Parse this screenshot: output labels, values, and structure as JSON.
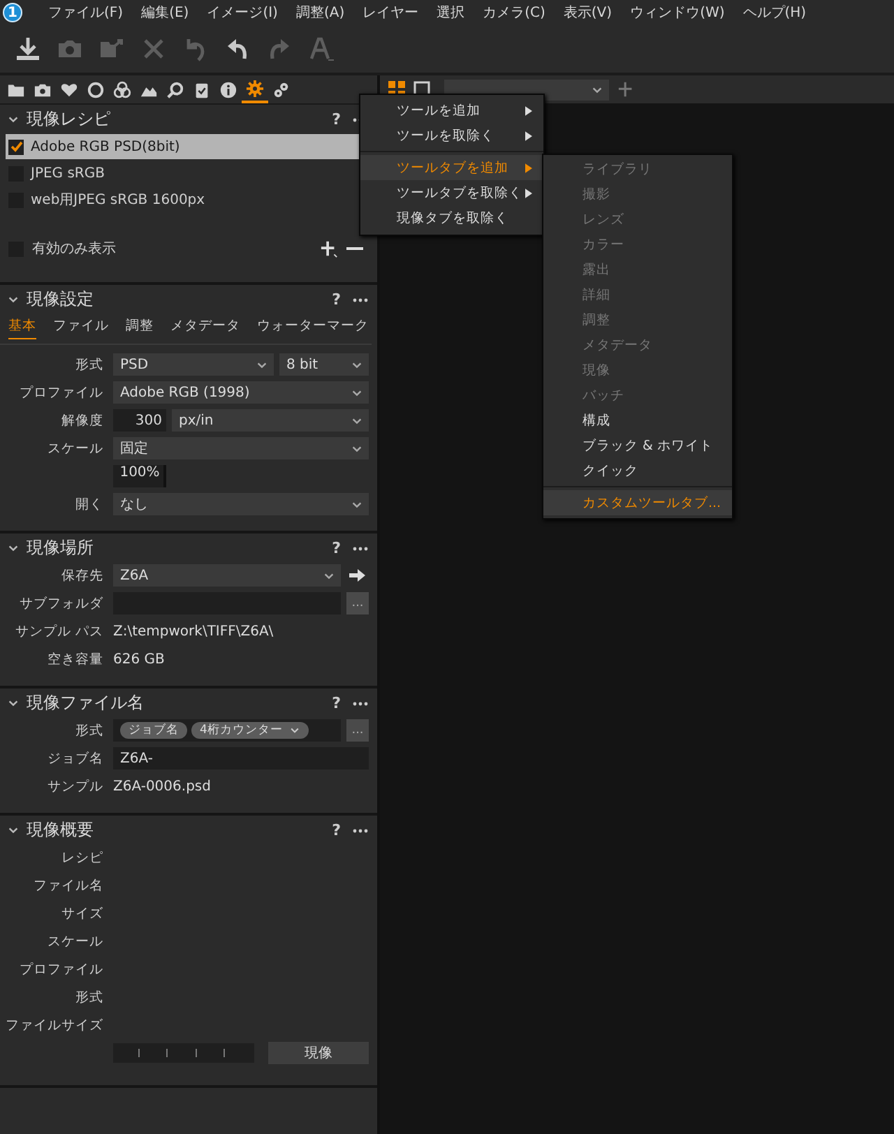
{
  "menubar": {
    "app_badge": "1",
    "items": [
      "ファイル(F)",
      "編集(E)",
      "イメージ(I)",
      "調整(A)",
      "レイヤー",
      "選択",
      "カメラ(C)",
      "表示(V)",
      "ウィンドウ(W)",
      "ヘルプ(H)"
    ]
  },
  "toolbar": [
    {
      "disabled": false
    },
    {
      "disabled": true
    },
    {
      "disabled": true
    },
    {
      "disabled": true
    },
    {
      "disabled": true
    },
    {
      "disabled": false
    },
    {
      "disabled": true
    },
    {
      "disabled": true
    }
  ],
  "tool_tabs": [
    {
      "selected": false
    },
    {
      "selected": false
    },
    {
      "selected": false
    },
    {
      "selected": false
    },
    {
      "selected": false
    },
    {
      "selected": false
    },
    {
      "selected": false
    },
    {
      "selected": false
    },
    {
      "selected": false
    },
    {
      "selected": true
    },
    {
      "selected": false
    }
  ],
  "viewer_modes": [
    {
      "selected": true
    },
    {
      "selected": false
    }
  ],
  "recipes": {
    "title": "現像レシピ",
    "help": "?",
    "expanded": true,
    "items": [
      {
        "name": "Adobe RGB PSD(8bit)",
        "checked": true,
        "selected": true
      },
      {
        "name": "JPEG sRGB",
        "checked": false,
        "selected": false
      },
      {
        "name": "web用JPEG sRGB 1600px",
        "checked": false,
        "selected": false
      }
    ],
    "filter": {
      "label": "有効のみ表示",
      "checked": false
    }
  },
  "settings": {
    "title": "現像設定",
    "help": "?",
    "expanded": true,
    "tabs": [
      {
        "label": "基本",
        "selected": true
      },
      {
        "label": "ファイル",
        "selected": false
      },
      {
        "label": "調整",
        "selected": false
      },
      {
        "label": "メタデータ",
        "selected": false
      },
      {
        "label": "ウォーターマーク",
        "selected": false
      }
    ],
    "rows": [
      {
        "kind": "double-select",
        "label": "形式",
        "value": "PSD",
        "value2": "8 bit"
      },
      {
        "kind": "select",
        "label": "プロファイル",
        "value": "Adobe RGB (1998)"
      },
      {
        "kind": "number-select",
        "label": "解像度",
        "value": "300",
        "value2": "px/in"
      },
      {
        "kind": "select",
        "label": "スケール",
        "value": "固定"
      },
      {
        "kind": "number",
        "value": "100%"
      },
      {
        "kind": "select",
        "label": "開く",
        "value": "なし"
      }
    ]
  },
  "location": {
    "title": "現像場所",
    "help": "?",
    "expanded": true,
    "rows": [
      {
        "kind": "select-arrow",
        "label": "保存先",
        "value": "Z6A"
      },
      {
        "kind": "field-button",
        "label": "サブフォルダ",
        "button": "..."
      },
      {
        "kind": "text",
        "label": "サンプル パス",
        "value": "Z:\\tempwork\\TIFF\\Z6A\\"
      },
      {
        "kind": "text",
        "label": "空き容量",
        "value": "626 GB"
      }
    ]
  },
  "filename": {
    "title": "現像ファイル名",
    "help": "?",
    "expanded": true,
    "rows": [
      {
        "kind": "tokens",
        "label": "形式",
        "tokens": [
          {
            "text": "ジョブ名",
            "dropdown": false
          },
          {
            "text": "4桁カウンター",
            "dropdown": true
          }
        ],
        "button": "..."
      },
      {
        "kind": "field",
        "label": "ジョブ名",
        "value": "Z6A-"
      },
      {
        "kind": "text",
        "label": "サンプル",
        "value": "Z6A-0006.psd"
      }
    ]
  },
  "summary": {
    "title": "現像概要",
    "help": "?",
    "expanded": true,
    "labels": [
      "レシピ",
      "ファイル名",
      "サイズ",
      "スケール",
      "プロファイル",
      "形式",
      "ファイルサイズ"
    ],
    "button": "現像"
  },
  "context_menu": [
    {
      "label": "ツールを追加",
      "submenu": true,
      "selected": false
    },
    {
      "label": "ツールを取除く",
      "submenu": true,
      "selected": false
    },
    {
      "label": "ツールタブを追加",
      "submenu": true,
      "selected": true
    },
    {
      "label": "ツールタブを取除く",
      "submenu": true,
      "selected": false
    },
    {
      "label": "現像タブを取除く",
      "submenu": false,
      "selected": false
    }
  ],
  "submenu": [
    {
      "label": "ライブラリ",
      "disabled": true,
      "selected": false
    },
    {
      "label": "撮影",
      "disabled": true,
      "selected": false
    },
    {
      "label": "レンズ",
      "disabled": true,
      "selected": false
    },
    {
      "label": "カラー",
      "disabled": true,
      "selected": false
    },
    {
      "label": "露出",
      "disabled": true,
      "selected": false
    },
    {
      "label": "詳細",
      "disabled": true,
      "selected": false
    },
    {
      "label": "調整",
      "disabled": true,
      "selected": false
    },
    {
      "label": "メタデータ",
      "disabled": true,
      "selected": false
    },
    {
      "label": "現像",
      "disabled": true,
      "selected": false
    },
    {
      "label": "バッチ",
      "disabled": true,
      "selected": false
    },
    {
      "label": "構成",
      "disabled": false,
      "selected": false
    },
    {
      "label": "ブラック & ホワイト",
      "disabled": false,
      "selected": false
    },
    {
      "label": "クイック",
      "disabled": false,
      "selected": false
    },
    {
      "label": "カスタムツールタブ...",
      "disabled": false,
      "selected": true
    }
  ]
}
